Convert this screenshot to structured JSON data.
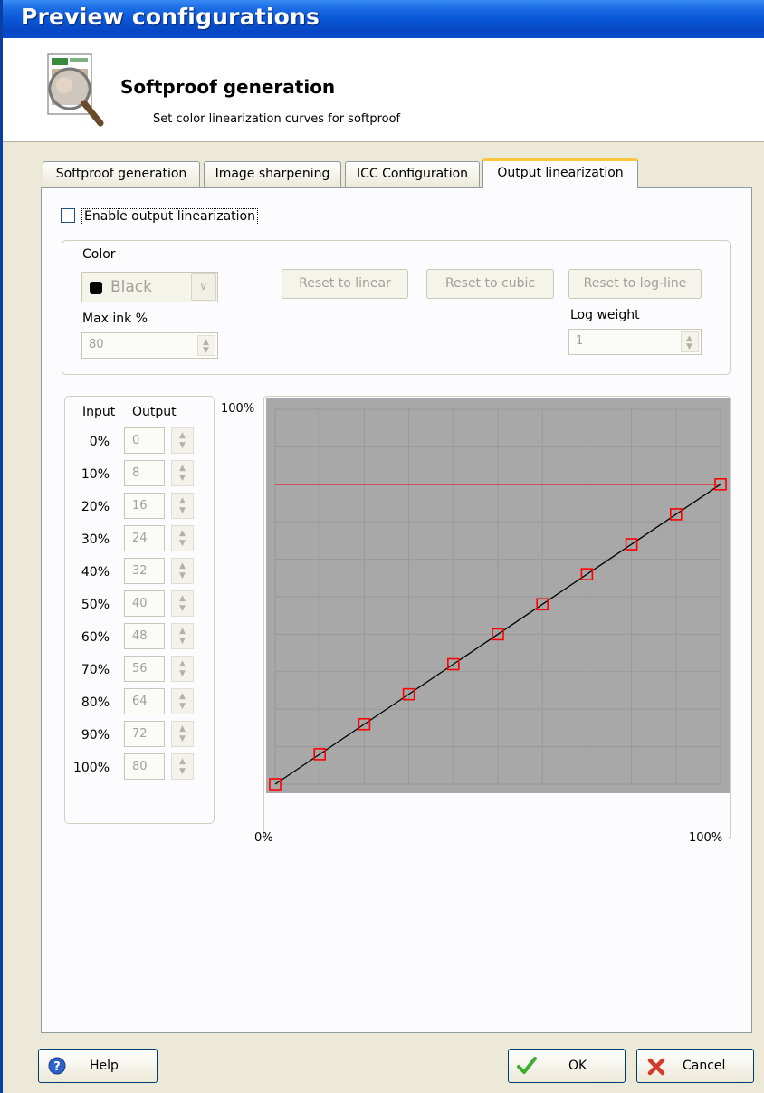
{
  "window": {
    "title": "Preview configurations"
  },
  "header": {
    "title": "Softproof generation",
    "subtitle": "Set color linearization curves for softproof"
  },
  "tabs": [
    {
      "label": "Softproof generation",
      "active": false
    },
    {
      "label": "Image sharpening",
      "active": false
    },
    {
      "label": "ICC Configuration",
      "active": false
    },
    {
      "label": "Output linearization",
      "active": true
    }
  ],
  "enable": {
    "label": "Enable output linearization",
    "checked": false
  },
  "settings": {
    "color_label": "Color",
    "color_value": "Black",
    "max_ink_label": "Max ink %",
    "max_ink_value": "80",
    "log_weight_label": "Log weight",
    "log_weight_value": "1",
    "reset_linear": "Reset to linear",
    "reset_cubic": "Reset to cubic",
    "reset_logline": "Reset to log-line"
  },
  "table": {
    "input_header": "Input",
    "output_header": "Output",
    "rows": [
      {
        "input": "0%",
        "output": "0"
      },
      {
        "input": "10%",
        "output": "8"
      },
      {
        "input": "20%",
        "output": "16"
      },
      {
        "input": "30%",
        "output": "24"
      },
      {
        "input": "40%",
        "output": "32"
      },
      {
        "input": "50%",
        "output": "40"
      },
      {
        "input": "60%",
        "output": "48"
      },
      {
        "input": "70%",
        "output": "56"
      },
      {
        "input": "80%",
        "output": "64"
      },
      {
        "input": "90%",
        "output": "72"
      },
      {
        "input": "100%",
        "output": "80"
      }
    ]
  },
  "chart_data": {
    "type": "line",
    "x_min_label": "0%",
    "x_max_label": "100%",
    "y_max_label": "100%",
    "xlim": [
      0,
      100
    ],
    "ylim": [
      0,
      100
    ],
    "grid": true,
    "max_ink_line": 80,
    "x": [
      0,
      10,
      20,
      30,
      40,
      50,
      60,
      70,
      80,
      90,
      100
    ],
    "y": [
      0,
      8,
      16,
      24,
      32,
      40,
      48,
      56,
      64,
      72,
      80
    ],
    "colors": {
      "background": "#a8a8a8",
      "grid": "#999999",
      "curve": "#000000",
      "marker": "#ff0000",
      "limit_line": "#ff0000"
    }
  },
  "footer": {
    "help_label": "Help",
    "ok_label": "OK",
    "cancel_label": "Cancel"
  }
}
